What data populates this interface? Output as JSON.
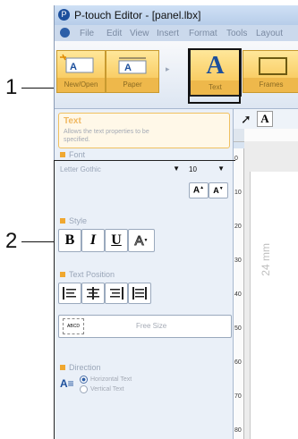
{
  "callouts": {
    "one": "1",
    "two": "2"
  },
  "window": {
    "title": "P-touch Editor - [panel.lbx]",
    "menu": [
      "File",
      "Edit",
      "View",
      "Insert",
      "Format",
      "Tools",
      "Layout"
    ]
  },
  "ribbon": {
    "tiles": [
      "New/Open",
      "Paper",
      "Text",
      "Frames"
    ]
  },
  "tooltip": {
    "title": "Text",
    "description": "Allows the text properties to be specified."
  },
  "panel": {
    "font": {
      "heading": "Font",
      "font_name": "Letter Gothic",
      "font_size": "10"
    },
    "style": {
      "heading": "Style"
    },
    "text_position": {
      "heading": "Text Position",
      "free_size_label": "Free Size",
      "free_size_icon_text": "ABCD"
    },
    "direction": {
      "heading": "Direction",
      "options": [
        "Horizontal Text",
        "Vertical Text"
      ]
    }
  },
  "ruler": {
    "ticks": [
      "0",
      "10",
      "20",
      "30",
      "40",
      "50",
      "60",
      "70",
      "80"
    ]
  },
  "canvas": {
    "size_label": "24 mm"
  },
  "colors": {
    "accent": "#f0a830",
    "ribbon_selected_border": "#222222"
  }
}
